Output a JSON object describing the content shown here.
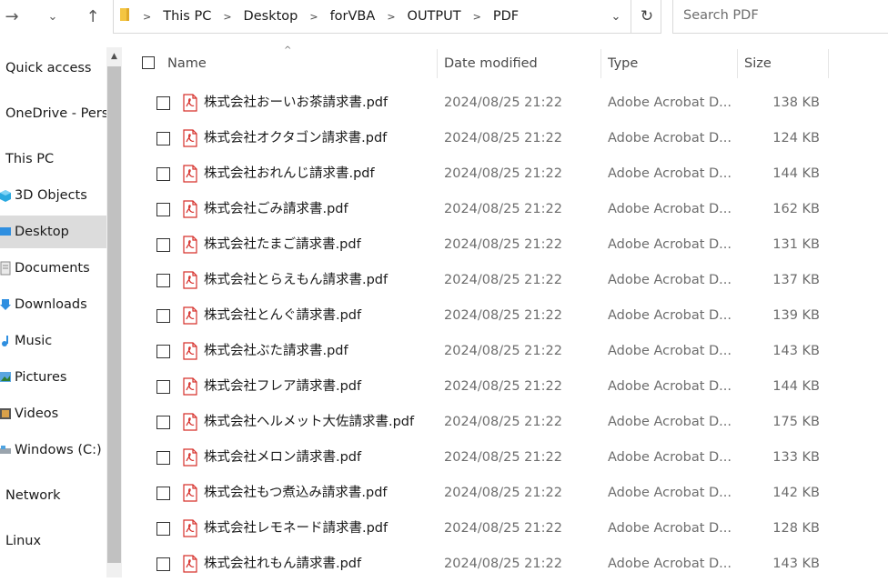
{
  "toolbar": {
    "forward_glyph": "→",
    "recent_glyph": "⌄",
    "up_glyph": "↑"
  },
  "address": {
    "crumbs": [
      "This PC",
      "Desktop",
      "forVBA",
      "OUTPUT",
      "PDF"
    ],
    "separator": ">",
    "dropdown_glyph": "⌄",
    "refresh_glyph": "↻"
  },
  "search": {
    "placeholder": "Search PDF"
  },
  "nav": {
    "items": [
      {
        "label": "Quick access",
        "icon": "star-icon"
      },
      {
        "label": "OneDrive - Perso",
        "icon": "cloud-icon"
      },
      {
        "label": "This PC",
        "icon": "computer-icon"
      },
      {
        "label": "3D Objects",
        "icon": "cube-icon"
      },
      {
        "label": "Desktop",
        "icon": "desktop-icon",
        "selected": true
      },
      {
        "label": "Documents",
        "icon": "document-icon"
      },
      {
        "label": "Downloads",
        "icon": "download-icon"
      },
      {
        "label": "Music",
        "icon": "music-icon"
      },
      {
        "label": "Pictures",
        "icon": "picture-icon"
      },
      {
        "label": "Videos",
        "icon": "video-icon"
      },
      {
        "label": "Windows (C:)",
        "icon": "drive-icon"
      },
      {
        "label": "Network",
        "icon": "network-icon"
      },
      {
        "label": "Linux",
        "icon": "linux-icon"
      }
    ]
  },
  "columns": {
    "name": "Name",
    "date": "Date modified",
    "type": "Type",
    "size": "Size",
    "sort_glyph": "^"
  },
  "files": [
    {
      "name": "株式会社おーいお茶請求書.pdf",
      "date": "2024/08/25 21:22",
      "type": "Adobe Acrobat D...",
      "size": "138 KB"
    },
    {
      "name": "株式会社オクタゴン請求書.pdf",
      "date": "2024/08/25 21:22",
      "type": "Adobe Acrobat D...",
      "size": "124 KB"
    },
    {
      "name": "株式会社おれんじ請求書.pdf",
      "date": "2024/08/25 21:22",
      "type": "Adobe Acrobat D...",
      "size": "144 KB"
    },
    {
      "name": "株式会社ごみ請求書.pdf",
      "date": "2024/08/25 21:22",
      "type": "Adobe Acrobat D...",
      "size": "162 KB"
    },
    {
      "name": "株式会社たまご請求書.pdf",
      "date": "2024/08/25 21:22",
      "type": "Adobe Acrobat D...",
      "size": "131 KB"
    },
    {
      "name": "株式会社とらえもん請求書.pdf",
      "date": "2024/08/25 21:22",
      "type": "Adobe Acrobat D...",
      "size": "137 KB"
    },
    {
      "name": "株式会社とんぐ請求書.pdf",
      "date": "2024/08/25 21:22",
      "type": "Adobe Acrobat D...",
      "size": "139 KB"
    },
    {
      "name": "株式会社ぶた請求書.pdf",
      "date": "2024/08/25 21:22",
      "type": "Adobe Acrobat D...",
      "size": "143 KB"
    },
    {
      "name": "株式会社フレア請求書.pdf",
      "date": "2024/08/25 21:22",
      "type": "Adobe Acrobat D...",
      "size": "144 KB"
    },
    {
      "name": "株式会社ヘルメット大佐請求書.pdf",
      "date": "2024/08/25 21:22",
      "type": "Adobe Acrobat D...",
      "size": "175 KB"
    },
    {
      "name": "株式会社メロン請求書.pdf",
      "date": "2024/08/25 21:22",
      "type": "Adobe Acrobat D...",
      "size": "133 KB"
    },
    {
      "name": "株式会社もつ煮込み請求書.pdf",
      "date": "2024/08/25 21:22",
      "type": "Adobe Acrobat D...",
      "size": "142 KB"
    },
    {
      "name": "株式会社レモネード請求書.pdf",
      "date": "2024/08/25 21:22",
      "type": "Adobe Acrobat D...",
      "size": "128 KB"
    },
    {
      "name": "株式会社れもん請求書.pdf",
      "date": "2024/08/25 21:22",
      "type": "Adobe Acrobat D...",
      "size": "143 KB"
    }
  ],
  "colors": {
    "pdf_red": "#d6302b",
    "folder_yellow": "#f4c542",
    "selected_bg": "#dcdcdc"
  }
}
